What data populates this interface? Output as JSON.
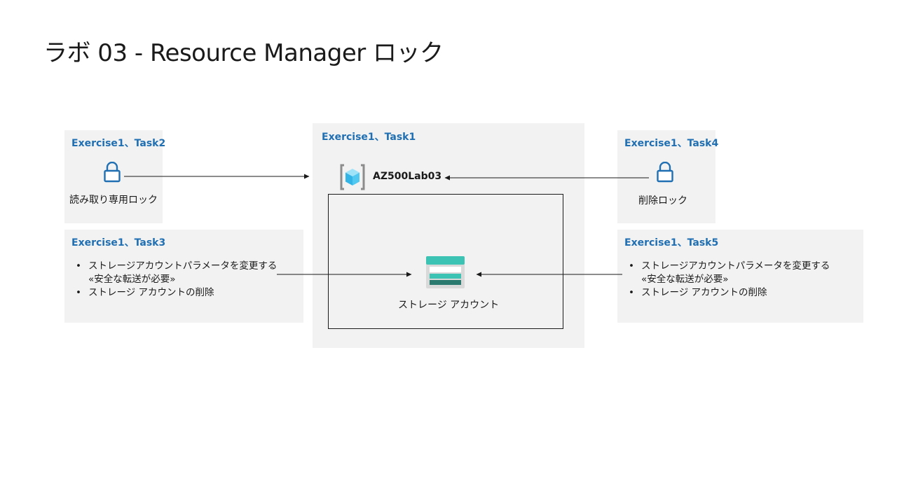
{
  "title": "ラボ 03 - Resource Manager ロック",
  "boxes": {
    "task2": {
      "heading": "Exercise1、Task2",
      "label": "読み取り専用ロック"
    },
    "task1": {
      "heading": "Exercise1、Task1",
      "resource_group": "AZ500Lab03",
      "storage_label": "ストレージ アカウント"
    },
    "task4": {
      "heading": "Exercise1、Task4",
      "label": "削除ロック"
    },
    "task3": {
      "heading": "Exercise1、Task3",
      "bullets": [
        {
          "line1": "ストレージアカウントパラメータを変更する",
          "line2": "«安全な転送が必要»"
        },
        {
          "line1": "ストレージ アカウントの削除",
          "line2": ""
        }
      ]
    },
    "task5": {
      "heading": "Exercise1、Task5",
      "bullets": [
        {
          "line1": "ストレージアカウントパラメータを変更する",
          "line2": "«安全な転送が必要»"
        },
        {
          "line1": "ストレージ アカウントの削除",
          "line2": ""
        }
      ]
    }
  },
  "icons": {
    "lock": "lock-icon",
    "resource_group": "resource-group-icon",
    "storage": "storage-account-icon"
  },
  "colors": {
    "heading": "#1f6fb2",
    "box_bg": "#f2f2f2",
    "lock_stroke": "#1f6fb2",
    "storage_teal": "#3cc3b4",
    "storage_dark": "#2a7a70",
    "cube": "#50c8f0"
  }
}
